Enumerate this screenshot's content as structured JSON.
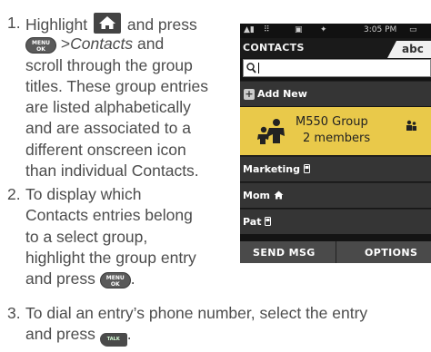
{
  "steps": [
    {
      "number": "1.",
      "part_highlight": "Highlight",
      "part_and_press": "and press",
      "part_sep": " >",
      "part_contacts": "Contacts",
      "part_and": " and",
      "lines": [
        "scroll through the group",
        "titles. These group entries",
        "are listed alphabetically",
        "and are associated to a",
        "different onscreen icon",
        "than individual Contacts."
      ]
    },
    {
      "number": "2.",
      "lines": [
        "To display which",
        "Contacts entries belong",
        "to a select group,",
        "highlight the group entry"
      ],
      "last_prefix": "and press",
      "last_suffix": "."
    },
    {
      "number": "3.",
      "lines": [
        "To dial an entry’s phone number, select the entry"
      ],
      "last_prefix": "and press",
      "last_suffix": "."
    }
  ],
  "keys": {
    "menu_top": "MENU",
    "menu_bottom": "OK",
    "talk": "TALK",
    "home_icon": "home-icon"
  },
  "phone": {
    "status_time": "3:05 PM",
    "title": "CONTACTS",
    "input_mode": "abc",
    "search_value": "",
    "add_new": "Add New",
    "group_name": "M550 Group",
    "group_members": "2 members",
    "contacts": [
      {
        "name": "Marketing",
        "icon": "phone-icon"
      },
      {
        "name": "Mom",
        "icon": "house-icon"
      },
      {
        "name": "Pat",
        "icon": "phone-icon"
      }
    ],
    "softkey_left": "SEND MSG",
    "softkey_right": "OPTIONS",
    "accent": "#e9c94a"
  }
}
